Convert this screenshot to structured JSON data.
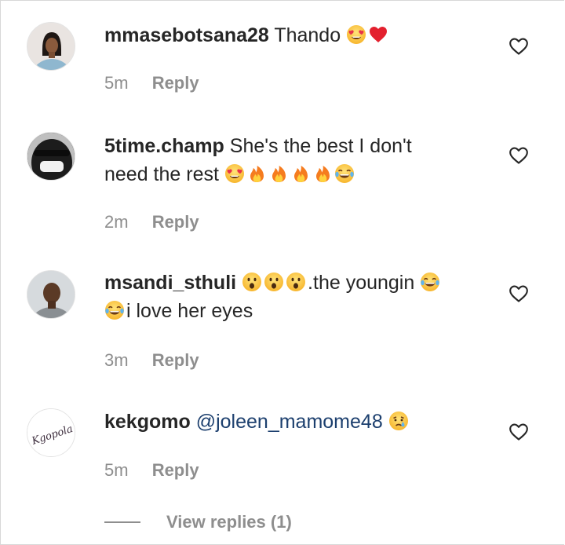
{
  "comments": [
    {
      "username": "mmasebotsana28",
      "text": "Thando",
      "text2": "",
      "emojis_after": [
        "heart-eyes-emoji",
        "red-heart-emoji"
      ],
      "time": "5m",
      "reply_label": "Reply"
    },
    {
      "username": "5time.champ",
      "text": "She's the best I don't",
      "text2": "need the rest",
      "emojis_after": [
        "heart-eyes-emoji",
        "fire-emoji",
        "fire-emoji",
        "fire-emoji",
        "fire-emoji",
        "joy-emoji"
      ],
      "time": "2m",
      "reply_label": "Reply"
    },
    {
      "username": "msandi_sthuli",
      "text": ".the youngin",
      "text2": "i love her eyes",
      "emojis_before": [
        "astonished-emoji",
        "astonished-emoji",
        "astonished-emoji"
      ],
      "time": "3m",
      "reply_label": "Reply"
    },
    {
      "username": "kekgomo",
      "mention": "@joleen_mamome48",
      "emojis_after": [
        "crying-emoji"
      ],
      "time": "5m",
      "reply_label": "Reply",
      "avatar_text": "Kgopola"
    }
  ],
  "view_replies": "View replies (1)",
  "icons": {
    "like": "heart-outline-icon"
  },
  "colors": {
    "text": "#262626",
    "meta": "#8e8e8e",
    "mention": "#1c3f6e"
  }
}
